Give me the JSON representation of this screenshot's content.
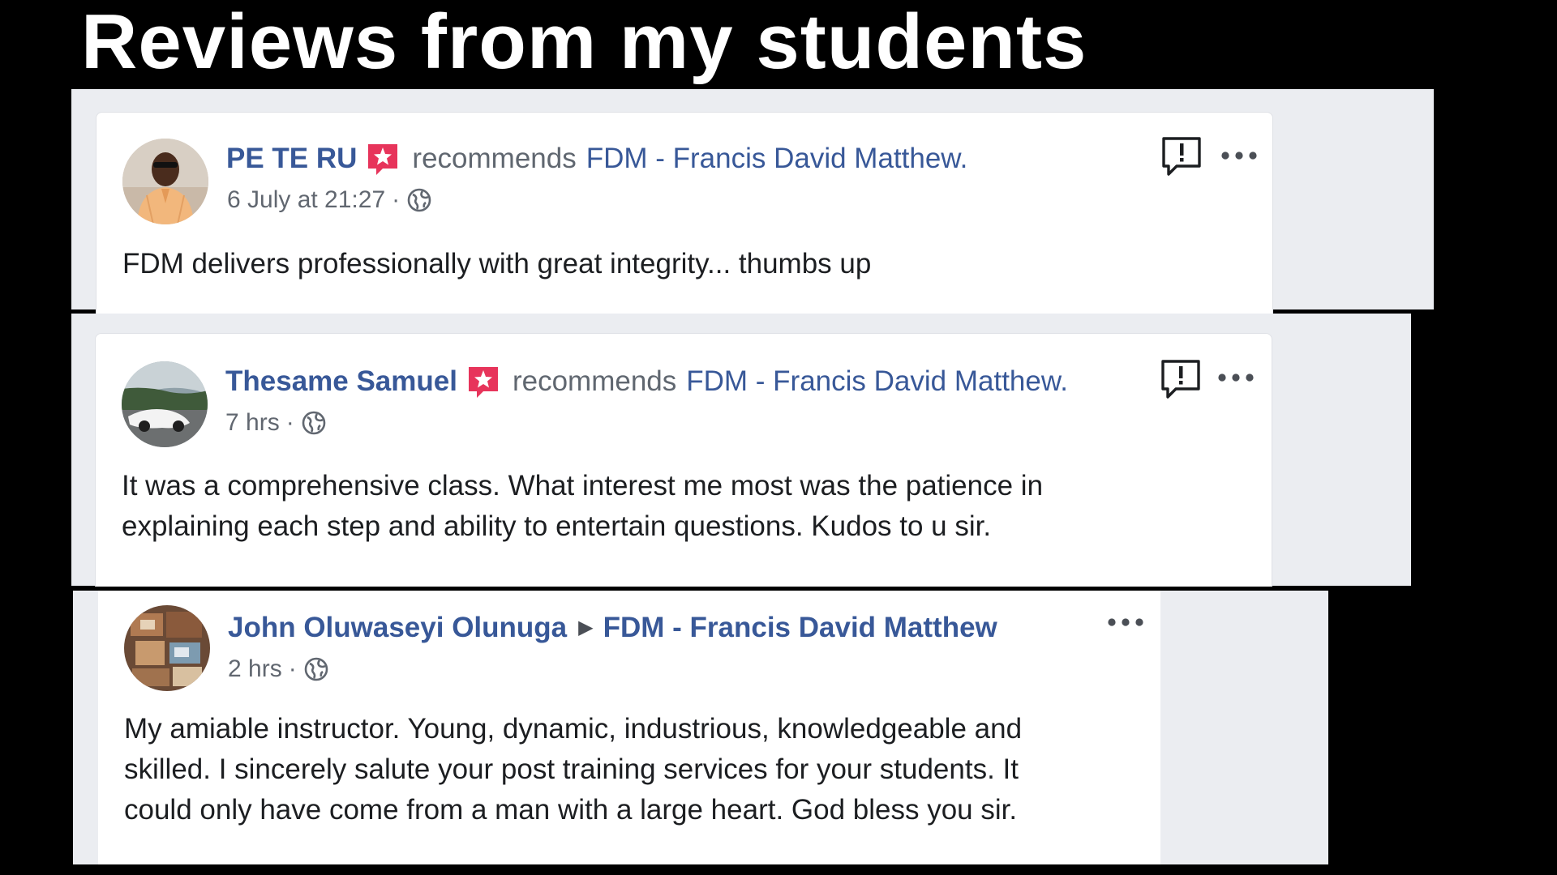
{
  "slide": {
    "title": "Reviews from my students"
  },
  "colors": {
    "background": "#000000",
    "panel": "#ebedf1",
    "card": "#ffffff",
    "link_blue": "#385898",
    "meta_gray": "#616770",
    "text_dark": "#1c1e21",
    "star_badge": "#e7345b"
  },
  "reviews": [
    {
      "author": "PE TE RU",
      "badge_icon": "recommendation-star-icon",
      "action": "recommends",
      "page": "FDM - Francis David Matthew.",
      "time": "6 July at 21:27",
      "separator": "·",
      "privacy_icon": "globe-icon",
      "text_lines": [
        "FDM delivers professionally with great integrity... thumbs up"
      ],
      "actions": [
        "report-icon",
        "more-options-icon"
      ]
    },
    {
      "author": "Thesame Samuel",
      "badge_icon": "recommendation-star-icon",
      "action": "recommends",
      "page": "FDM - Francis David Matthew.",
      "time": "7 hrs",
      "separator": "·",
      "privacy_icon": "globe-icon",
      "text_lines": [
        "It was a comprehensive class. What interest me most was the patience in",
        "explaining each step and ability to entertain questions. Kudos to u sir."
      ],
      "actions": [
        "report-icon",
        "more-options-icon"
      ]
    },
    {
      "author": "John Oluwaseyi Olunuga",
      "arrow_icon": "right-triangle-icon",
      "page": "FDM - Francis David Matthew",
      "time": "2 hrs",
      "separator": "·",
      "privacy_icon": "globe-icon",
      "text_lines": [
        "My amiable instructor. Young, dynamic, industrious, knowledgeable and",
        "skilled. I sincerely salute your post training services for your students. It",
        "could only have come from a man with a large heart. God bless you sir."
      ],
      "actions": [
        "more-options-icon"
      ]
    }
  ]
}
